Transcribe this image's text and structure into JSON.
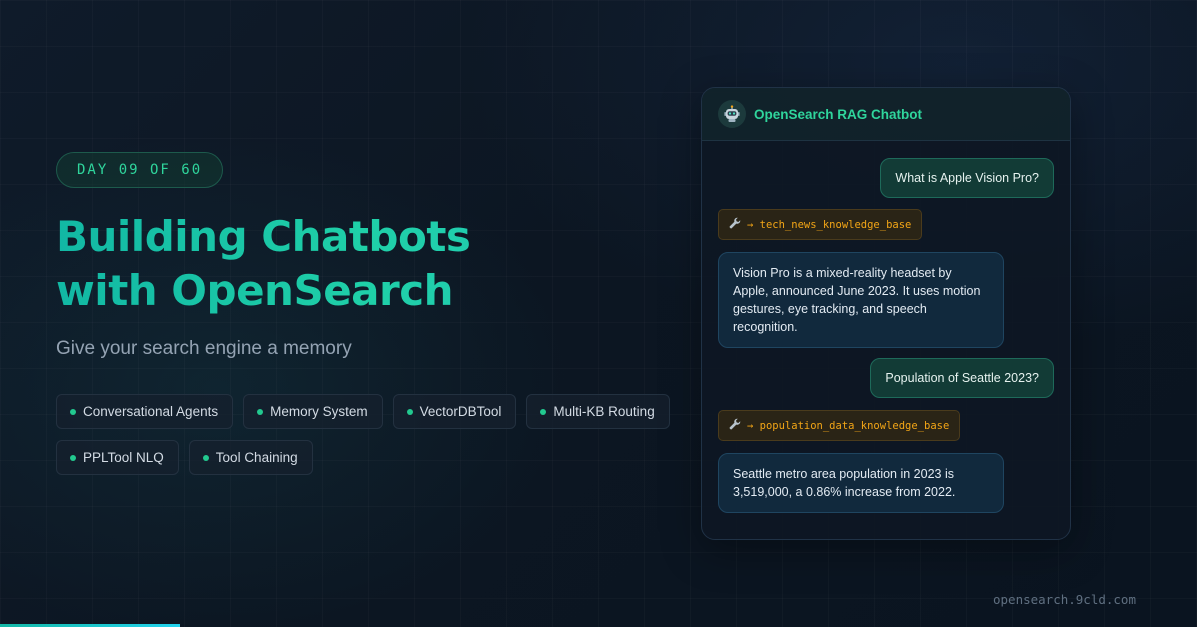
{
  "hero": {
    "badge": "DAY 09 OF 60",
    "title_line1": "Building Chatbots",
    "title_line2": "with OpenSearch",
    "subtitle": "Give your search engine a memory"
  },
  "tags": [
    "Conversational Agents",
    "Memory System",
    "VectorDBTool",
    "Multi-KB Routing",
    "PPLTool NLQ",
    "Tool Chaining"
  ],
  "chat": {
    "title": "OpenSearch RAG Chatbot",
    "avatar_icon": "robot-icon",
    "messages": {
      "user1": "What is Apple Vision Pro?",
      "tool1": "→ tech_news_knowledge_base",
      "bot1": "Vision Pro is a mixed-reality headset by Apple, announced June 2023. It uses motion gestures, eye tracking, and speech recognition.",
      "user2": "Population of Seattle 2023?",
      "tool2": "→ population_data_knowledge_base",
      "bot2": "Seattle metro area population in 2023 is 3,519,000, a 0.86% increase from 2022."
    },
    "tool_icon": "wrench-icon"
  },
  "footer": {
    "url": "opensearch.9cld.com"
  },
  "progress": {
    "current_day": 9,
    "total_days": 60
  },
  "colors": {
    "accent_green": "#2fd59c",
    "title_teal": "#1fd0a8",
    "tool_orange": "#f2a516",
    "background": "#0c1622"
  }
}
